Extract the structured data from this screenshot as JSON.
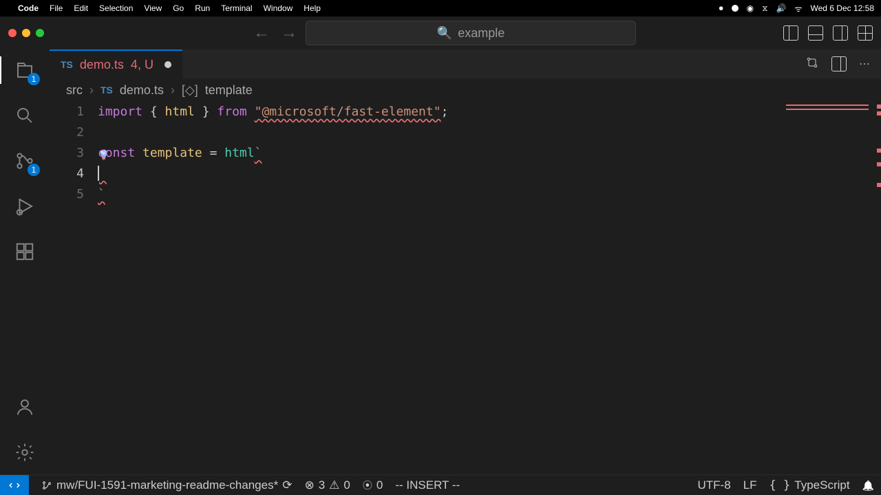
{
  "menubar": {
    "app": "Code",
    "items": [
      "File",
      "Edit",
      "Selection",
      "View",
      "Go",
      "Run",
      "Terminal",
      "Window",
      "Help"
    ],
    "clock": "Wed 6 Dec  12:58"
  },
  "titlebar": {
    "search_text": "example"
  },
  "activitybar": {
    "explorer_badge": "1",
    "scm_badge": "1"
  },
  "tab": {
    "filename": "demo.ts",
    "problem_count": "4",
    "git_status": "U"
  },
  "breadcrumbs": {
    "folder": "src",
    "file": "demo.ts",
    "symbol": "template"
  },
  "code": {
    "line1_import": "import",
    "line1_brace_open": " { ",
    "line1_html": "html",
    "line1_brace_close": " } ",
    "line1_from": "from",
    "line1_space": " ",
    "line1_str": "\"@microsoft/fast-element\"",
    "line1_semi": ";",
    "line3_const": "const",
    "line3_sp1": " ",
    "line3_name": "template",
    "line3_eq": " = ",
    "line3_fn": "html",
    "line3_tick": "`",
    "line5_tick": "`",
    "lines": [
      "1",
      "2",
      "3",
      "4",
      "5"
    ]
  },
  "statusbar": {
    "branch": "mw/FUI-1591-marketing-readme-changes*",
    "errors": "3",
    "warnings": "0",
    "ports": "0",
    "mode": "-- INSERT --",
    "encoding": "UTF-8",
    "eol": "LF",
    "lang": "TypeScript"
  }
}
